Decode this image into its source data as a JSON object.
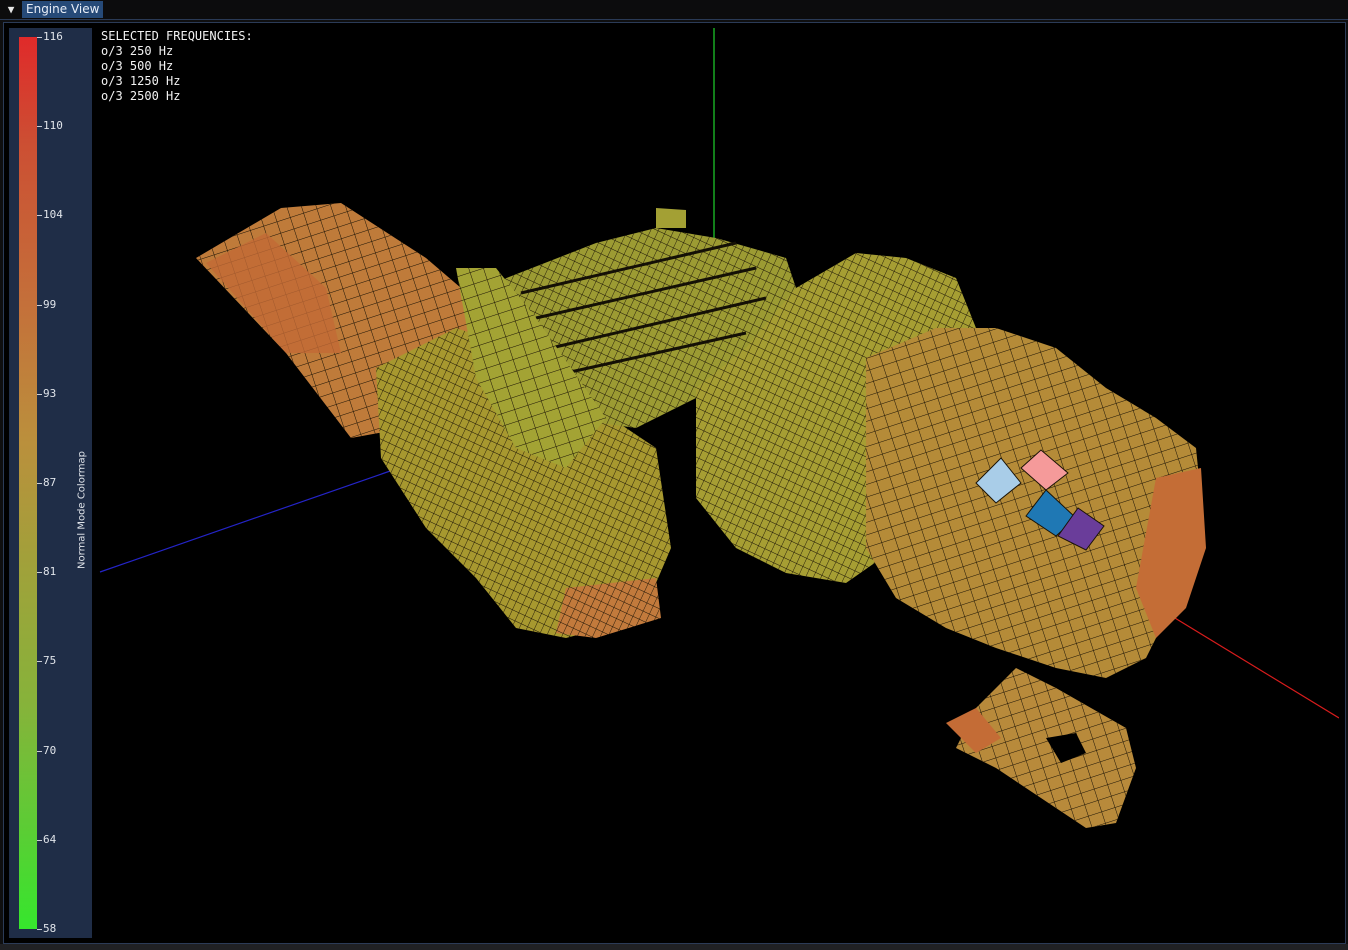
{
  "window": {
    "tab_label": "Engine View",
    "collapse_icon": "triangle-down-icon"
  },
  "colormap": {
    "title": "Normal Mode Colormap",
    "ticks": [
      "116",
      "110",
      "104",
      "99",
      "93",
      "87",
      "81",
      "75",
      "70",
      "64",
      "58"
    ],
    "colors": {
      "high": "#e02a2a",
      "mid": "#bb8f3c",
      "low": "#36e62d"
    }
  },
  "overlay": {
    "header": "SELECTED FREQUENCIES:",
    "lines": [
      "o/3 250 Hz",
      "o/3 500 Hz",
      "o/3 1250 Hz",
      "o/3 2500 Hz"
    ]
  },
  "highlight_colors": [
    "#a9cde8",
    "#f59a9a",
    "#1f78b4",
    "#6a3d9a"
  ]
}
